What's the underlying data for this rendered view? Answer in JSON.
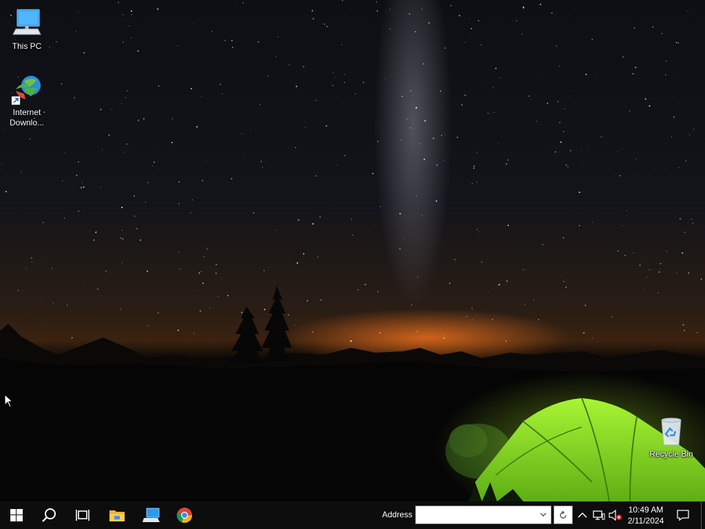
{
  "desktop": {
    "icons": [
      {
        "label": "This PC",
        "icon": "this-pc-icon"
      },
      {
        "label": "Internet Downlo...",
        "icon": "internet-download-manager-icon"
      },
      {
        "label": "Recycle Bin",
        "icon": "recycle-bin-icon"
      }
    ],
    "wallpaper": "night sky with milky way and glowing green tent"
  },
  "taskbar": {
    "pinned": [
      {
        "name": "start-button",
        "icon": "windows-logo-icon"
      },
      {
        "name": "search-button",
        "icon": "search-icon"
      },
      {
        "name": "task-view-button",
        "icon": "task-view-icon"
      },
      {
        "name": "file-explorer-button",
        "icon": "folder-icon"
      },
      {
        "name": "remote-desktop-button",
        "icon": "monitor-icon"
      },
      {
        "name": "chrome-button",
        "icon": "chrome-icon"
      }
    ],
    "address": {
      "label": "Address",
      "value": ""
    },
    "tray": {
      "icons": [
        "chevron-up-icon",
        "network-icon",
        "volume-muted-icon"
      ],
      "time": "10:49 AM",
      "date": "2/11/2024"
    },
    "colors": {
      "background": "#0d0d0d",
      "text": "#ffffff",
      "start_accent": "#ffffff"
    }
  }
}
